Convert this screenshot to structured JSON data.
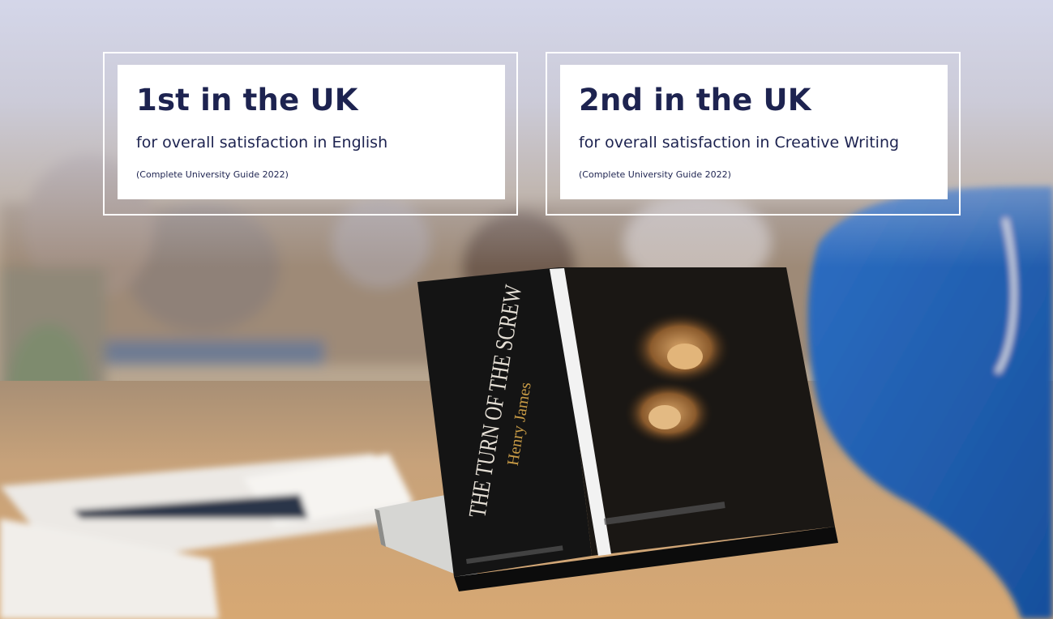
{
  "stats": [
    {
      "rank": "1st in the UK",
      "description": "for overall satisfaction in English",
      "source": "(Complete University Guide 2022)"
    },
    {
      "rank": "2nd in the UK",
      "description": "for overall satisfaction in Creative Writing",
      "source": "(Complete University Guide 2022)"
    }
  ],
  "photo": {
    "book_title": "THE TURN OF THE SCREW",
    "book_author": "Henry James"
  }
}
